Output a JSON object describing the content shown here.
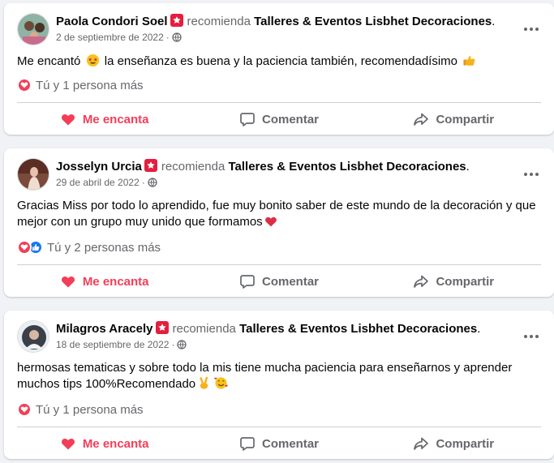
{
  "colors": {
    "love": "#f33e58",
    "like": "#1877f2",
    "badge": "#e41e3f",
    "secondary_text": "#65676b",
    "divider": "#ced0d4",
    "background": "#f0f2f5"
  },
  "actions": {
    "love_label": "Me encanta",
    "comment_label": "Comentar",
    "share_label": "Compartir"
  },
  "reviews": [
    {
      "author": "Paola Condori Soel",
      "recommends": "recomienda",
      "page": "Talleres & Eventos Lisbhet Decoraciones",
      "page_suffix": ".",
      "date": "2 de septiembre de 2022",
      "separator": "·",
      "text": "Me encantó",
      "text_after_emoji": "la enseñanza es buena y la paciencia también, recomendadísimo",
      "emojis": [
        "star-struck-emoji",
        "thumbs-up-emoji"
      ],
      "reactions_text": "Tú y 1 persona más",
      "reaction_icons": [
        "heart"
      ]
    },
    {
      "author": "Josselyn Urcia",
      "recommends": "recomienda",
      "page": "Talleres & Eventos Lisbhet Decoraciones",
      "page_suffix": ".",
      "date": "29 de abril de 2022",
      "separator": "·",
      "text_line1": "Gracias Miss por todo lo aprendido, fue muy bonito saber de este mundo de la decoración y que",
      "text_line2": "mejor con un grupo muy unido que formamos",
      "emojis": [
        "red-heart-emoji"
      ],
      "reactions_text": "Tú y 2 personas más",
      "reaction_icons": [
        "heart",
        "like"
      ]
    },
    {
      "author": "Milagros Aracely",
      "recommends": "recomienda",
      "page": "Talleres & Eventos Lisbhet Decoraciones",
      "page_suffix": ".",
      "date": "18 de septiembre de 2022",
      "separator": "·",
      "text_line1": "hermosas tematicas y sobre todo la mis tiene mucha paciencia para enseñarnos y aprender",
      "text_line2": "muchos tips 100%Recomendado",
      "emojis": [
        "victory-hand-emoji",
        "smiling-face-with-hearts-emoji"
      ],
      "reactions_text": "Tú y 1 persona más",
      "reaction_icons": [
        "heart"
      ]
    }
  ]
}
